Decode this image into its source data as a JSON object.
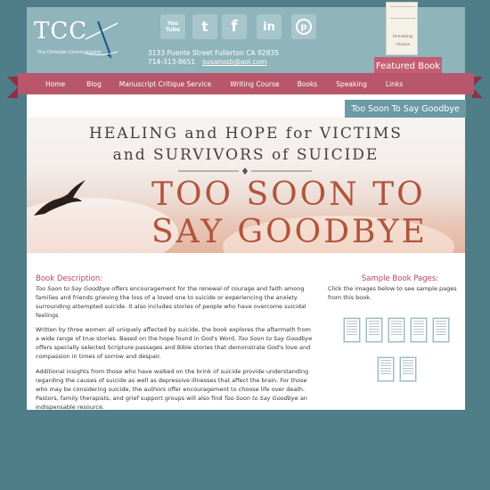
{
  "logo": {
    "text": "TCC",
    "tagline": "The Christian Communicator"
  },
  "social": [
    {
      "icon": "youtube-icon",
      "label": "You\nTube"
    },
    {
      "icon": "twitter-icon",
      "label": "t"
    },
    {
      "icon": "facebook-icon",
      "label": "f"
    },
    {
      "icon": "linkedin-icon",
      "label": "in"
    },
    {
      "icon": "pinterest-icon",
      "label": "p"
    }
  ],
  "contact": {
    "address": "3133 Puente Street Fullerton CA 92835",
    "phone": "714-313-8651",
    "email": "susanosb@aol.com"
  },
  "featured": {
    "tag": "Featured Book",
    "thumb_line1": "breaking",
    "thumb_line2": "chains"
  },
  "nav": {
    "items": [
      "Home",
      "Blog",
      "Manuscript Critique Service",
      "Writing Course",
      "Books",
      "Speaking",
      "Links"
    ]
  },
  "book_title_tab": "Too Soon To Say Goodbye",
  "banner": {
    "line1": "HEALING and HOPE for VICTIMS",
    "line2": "and SURVIVORS of SUICIDE",
    "line3": "TOO SOON TO",
    "line4": "SAY GOODBYE"
  },
  "description": {
    "heading": "Book Description:",
    "p1_title": "Too Soon to Say Goodbye",
    "p1_rest": " offers encouragement for the renewal of courage and faith among families and friends grieving the loss of a loved one to suicide or experiencing the anxiety surrounding attempted suicide. It also includes stories of people who have overcome suicidal feelings",
    "p2_a": "Written by three women all uniquely affected by suicide, the book explores the aftermath from a wide range of true stories. Based on the hope found in God's Word, ",
    "p2_title": "Too Soon to Say Goodbye",
    "p2_b": " offers specially selected Scripture passages and Bible stories that demonstrate God's love and compassion in times of sorrow and despair.",
    "p3_a": "Additional insights from those who have walked on the brink of suicide provide understanding regarding the causes of suicide as well as depressive illnesses that affect the brain. For those who may be considering suicide, the authors offer encouragement to choose life over death. Pastors, family therapists, and grief support groups will also find ",
    "p3_title": "Too Soon to Say Goodbye",
    "p3_b": " an indispensable resource."
  },
  "samples": {
    "heading": "Sample Book Pages:",
    "note": "Click the images below to see sample pages from this book."
  },
  "colors": {
    "background": "#4f7d88",
    "header": "#8fb4bb",
    "ribbon": "#b8566b",
    "accent_text": "#b7455c",
    "title_tab": "#6a9aa4"
  }
}
